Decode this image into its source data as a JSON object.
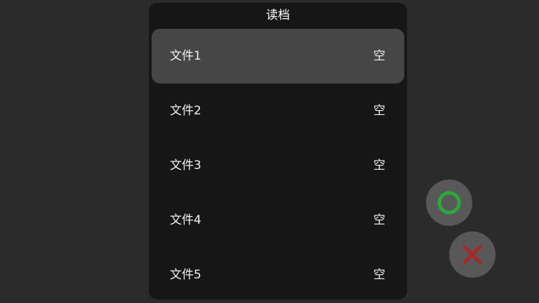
{
  "dialog": {
    "title": "读档"
  },
  "slots": [
    {
      "name": "文件1",
      "status": "空",
      "selected": true
    },
    {
      "name": "文件2",
      "status": "空",
      "selected": false
    },
    {
      "name": "文件3",
      "status": "空",
      "selected": false
    },
    {
      "name": "文件4",
      "status": "空",
      "selected": false
    },
    {
      "name": "文件5",
      "status": "空",
      "selected": false
    }
  ],
  "buttons": {
    "confirm_icon": "circle-icon",
    "cancel_icon": "cross-icon",
    "confirm_color": "#2aa83a",
    "cancel_color": "#a8282a"
  },
  "colors": {
    "background": "#2b2b2b",
    "dialog": "#161616",
    "selected_row": "#464646",
    "button": "#585858"
  }
}
